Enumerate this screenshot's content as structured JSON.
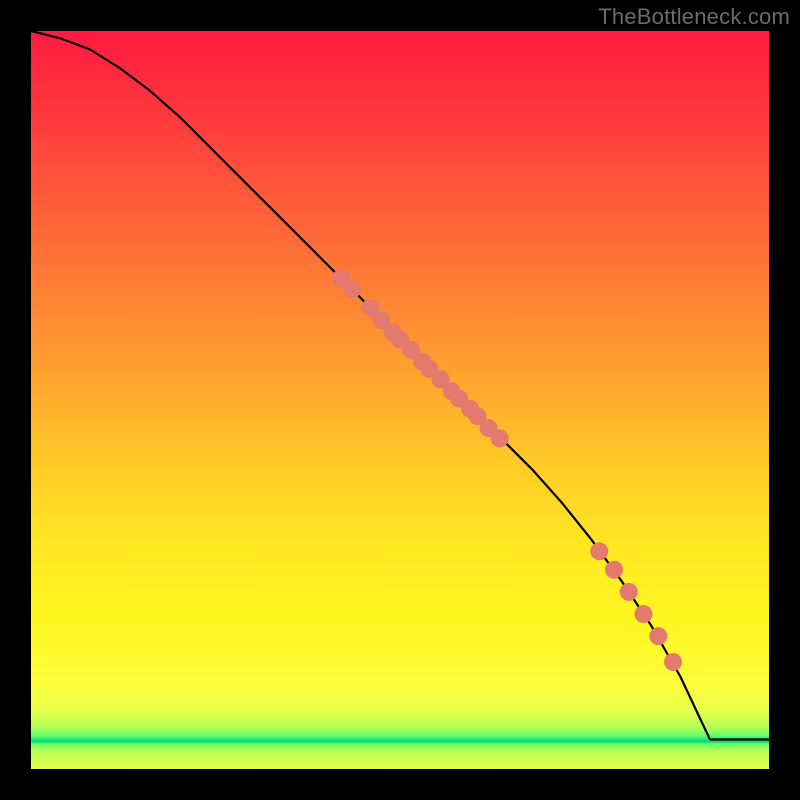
{
  "watermark": "TheBottleneck.com",
  "chart_data": {
    "type": "line",
    "title": "",
    "xlabel": "",
    "ylabel": "",
    "xlim": [
      0,
      100
    ],
    "ylim": [
      0,
      100
    ],
    "grid": false,
    "legend": false,
    "series": [
      {
        "name": "curve",
        "x": [
          0,
          4,
          8,
          12,
          16,
          20,
          24,
          28,
          32,
          36,
          40,
          44,
          48,
          52,
          56,
          60,
          64,
          68,
          72,
          76,
          80,
          84,
          88,
          92
        ],
        "y": [
          100,
          99,
          97.5,
          95,
          92,
          88.5,
          84.5,
          80.5,
          76.5,
          72.5,
          68.5,
          64.5,
          60.5,
          56.5,
          52.5,
          48.5,
          44.5,
          40.5,
          36,
          31,
          25.5,
          19.5,
          12.5,
          4
        ],
        "color": "#000000"
      },
      {
        "name": "flat-tail",
        "x": [
          92,
          100
        ],
        "y": [
          4,
          4
        ],
        "color": "#000000"
      }
    ],
    "points": {
      "name": "highlighted-dots",
      "color": "#e47a6e",
      "radius_px": 9,
      "xy": [
        [
          42,
          66.5
        ],
        [
          43.5,
          65
        ],
        [
          46,
          62.5
        ],
        [
          47.5,
          60.8
        ],
        [
          49,
          59.2
        ],
        [
          50,
          58.2
        ],
        [
          51.5,
          56.8
        ],
        [
          53,
          55.2
        ],
        [
          54,
          54.2
        ],
        [
          55.5,
          52.8
        ],
        [
          57,
          51.2
        ],
        [
          58,
          50.2
        ],
        [
          59.5,
          48.8
        ],
        [
          60.5,
          47.8
        ],
        [
          62,
          46.2
        ],
        [
          63.5,
          44.8
        ],
        [
          77,
          29.5
        ],
        [
          79,
          27
        ],
        [
          81,
          24
        ],
        [
          83,
          21
        ],
        [
          85,
          18
        ],
        [
          87,
          14.5
        ]
      ]
    }
  }
}
